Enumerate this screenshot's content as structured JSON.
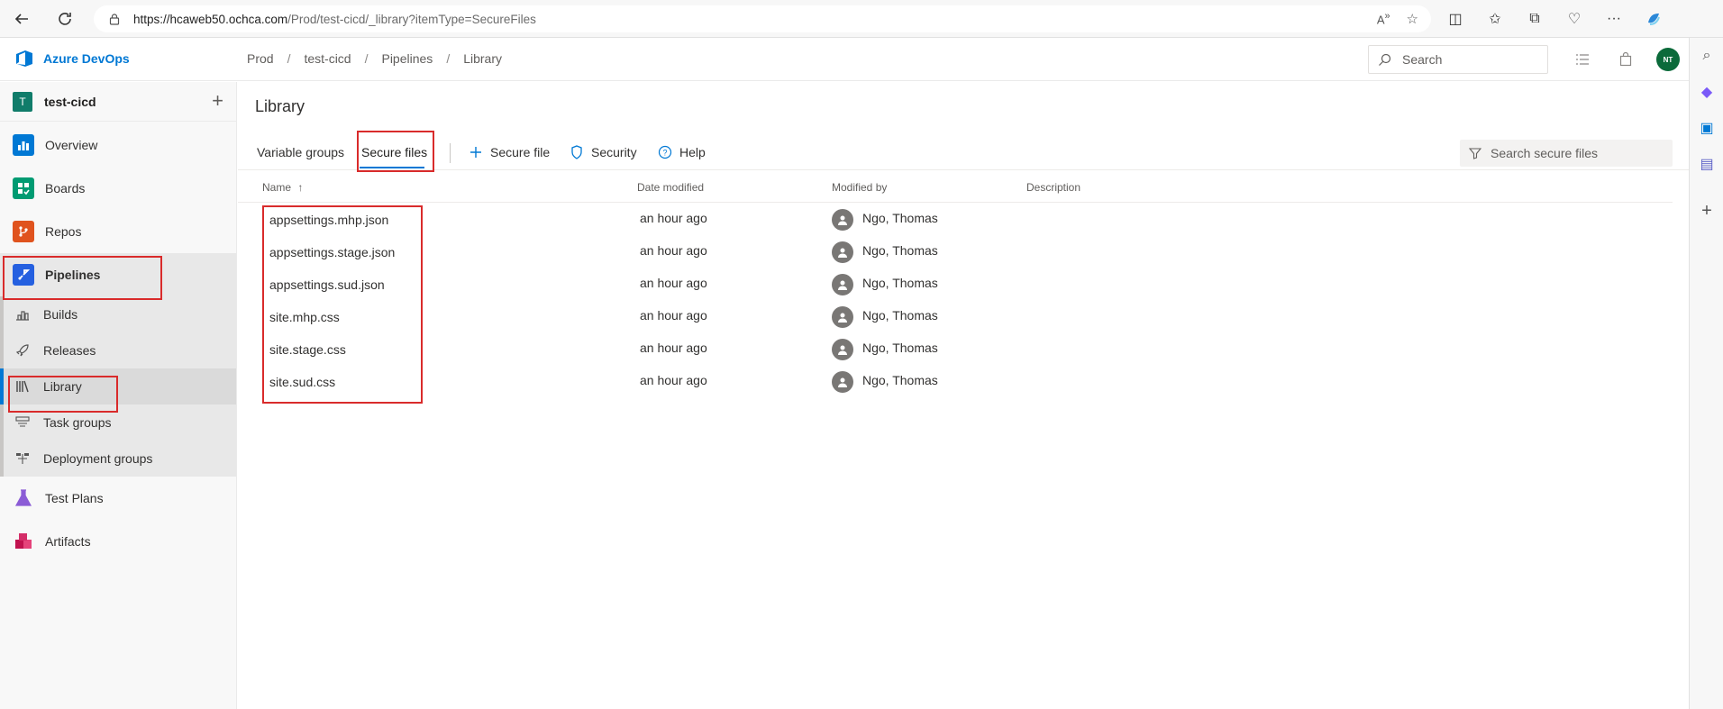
{
  "browser": {
    "url_host": "https://hcaweb50.ochca.com",
    "url_path": "/Prod/test-cicd/_library?itemType=SecureFiles"
  },
  "app": {
    "name": "Azure DevOps",
    "breadcrumb": [
      "Prod",
      "test-cicd",
      "Pipelines",
      "Library"
    ],
    "search_placeholder": "Search",
    "user_initials": "NT"
  },
  "project": {
    "badge": "T",
    "name": "test-cicd"
  },
  "nav": {
    "items": [
      {
        "label": "Overview"
      },
      {
        "label": "Boards"
      },
      {
        "label": "Repos"
      },
      {
        "label": "Pipelines"
      },
      {
        "label": "Test Plans"
      },
      {
        "label": "Artifacts"
      }
    ],
    "pipelines_sub": [
      {
        "label": "Builds"
      },
      {
        "label": "Releases"
      },
      {
        "label": "Library"
      },
      {
        "label": "Task groups"
      },
      {
        "label": "Deployment groups"
      }
    ]
  },
  "page": {
    "title": "Library",
    "tabs": [
      "Variable groups",
      "Secure files"
    ],
    "commands": {
      "add": "Secure file",
      "security": "Security",
      "help": "Help"
    },
    "filter_placeholder": "Search secure files",
    "columns": [
      "Name",
      "Date modified",
      "Modified by",
      "Description"
    ],
    "rows": [
      {
        "name": "appsettings.mhp.json",
        "modified": "an hour ago",
        "by": "Ngo, Thomas",
        "desc": ""
      },
      {
        "name": "appsettings.stage.json",
        "modified": "an hour ago",
        "by": "Ngo, Thomas",
        "desc": ""
      },
      {
        "name": "appsettings.sud.json",
        "modified": "an hour ago",
        "by": "Ngo, Thomas",
        "desc": ""
      },
      {
        "name": "site.mhp.css",
        "modified": "an hour ago",
        "by": "Ngo, Thomas",
        "desc": ""
      },
      {
        "name": "site.stage.css",
        "modified": "an hour ago",
        "by": "Ngo, Thomas",
        "desc": ""
      },
      {
        "name": "site.sud.css",
        "modified": "an hour ago",
        "by": "Ngo, Thomas",
        "desc": ""
      }
    ]
  }
}
